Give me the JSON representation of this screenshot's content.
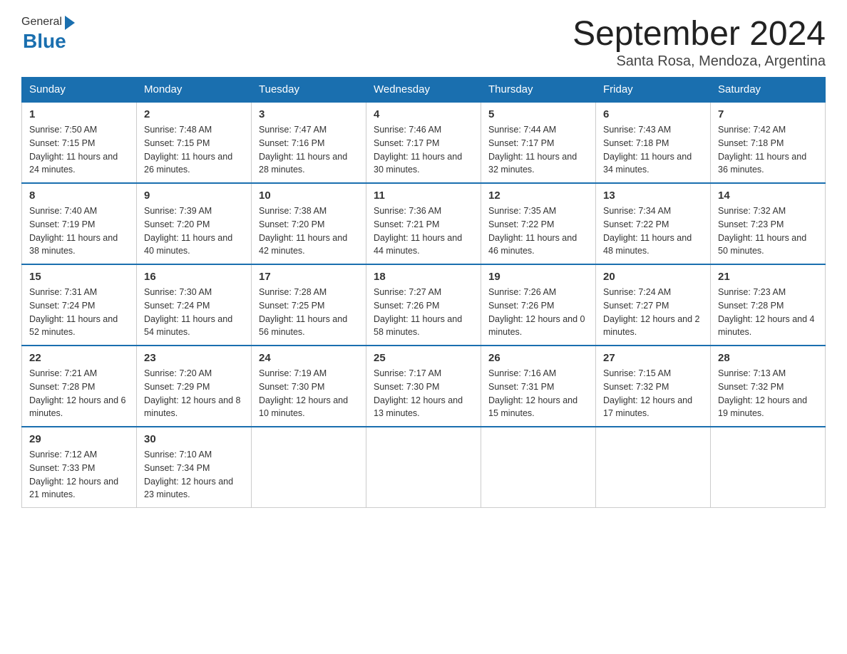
{
  "header": {
    "logo_general": "General",
    "logo_blue": "Blue",
    "month_title": "September 2024",
    "location": "Santa Rosa, Mendoza, Argentina"
  },
  "weekdays": [
    "Sunday",
    "Monday",
    "Tuesday",
    "Wednesday",
    "Thursday",
    "Friday",
    "Saturday"
  ],
  "weeks": [
    [
      {
        "day": "1",
        "sunrise": "7:50 AM",
        "sunset": "7:15 PM",
        "daylight": "11 hours and 24 minutes."
      },
      {
        "day": "2",
        "sunrise": "7:48 AM",
        "sunset": "7:15 PM",
        "daylight": "11 hours and 26 minutes."
      },
      {
        "day": "3",
        "sunrise": "7:47 AM",
        "sunset": "7:16 PM",
        "daylight": "11 hours and 28 minutes."
      },
      {
        "day": "4",
        "sunrise": "7:46 AM",
        "sunset": "7:17 PM",
        "daylight": "11 hours and 30 minutes."
      },
      {
        "day": "5",
        "sunrise": "7:44 AM",
        "sunset": "7:17 PM",
        "daylight": "11 hours and 32 minutes."
      },
      {
        "day": "6",
        "sunrise": "7:43 AM",
        "sunset": "7:18 PM",
        "daylight": "11 hours and 34 minutes."
      },
      {
        "day": "7",
        "sunrise": "7:42 AM",
        "sunset": "7:18 PM",
        "daylight": "11 hours and 36 minutes."
      }
    ],
    [
      {
        "day": "8",
        "sunrise": "7:40 AM",
        "sunset": "7:19 PM",
        "daylight": "11 hours and 38 minutes."
      },
      {
        "day": "9",
        "sunrise": "7:39 AM",
        "sunset": "7:20 PM",
        "daylight": "11 hours and 40 minutes."
      },
      {
        "day": "10",
        "sunrise": "7:38 AM",
        "sunset": "7:20 PM",
        "daylight": "11 hours and 42 minutes."
      },
      {
        "day": "11",
        "sunrise": "7:36 AM",
        "sunset": "7:21 PM",
        "daylight": "11 hours and 44 minutes."
      },
      {
        "day": "12",
        "sunrise": "7:35 AM",
        "sunset": "7:22 PM",
        "daylight": "11 hours and 46 minutes."
      },
      {
        "day": "13",
        "sunrise": "7:34 AM",
        "sunset": "7:22 PM",
        "daylight": "11 hours and 48 minutes."
      },
      {
        "day": "14",
        "sunrise": "7:32 AM",
        "sunset": "7:23 PM",
        "daylight": "11 hours and 50 minutes."
      }
    ],
    [
      {
        "day": "15",
        "sunrise": "7:31 AM",
        "sunset": "7:24 PM",
        "daylight": "11 hours and 52 minutes."
      },
      {
        "day": "16",
        "sunrise": "7:30 AM",
        "sunset": "7:24 PM",
        "daylight": "11 hours and 54 minutes."
      },
      {
        "day": "17",
        "sunrise": "7:28 AM",
        "sunset": "7:25 PM",
        "daylight": "11 hours and 56 minutes."
      },
      {
        "day": "18",
        "sunrise": "7:27 AM",
        "sunset": "7:26 PM",
        "daylight": "11 hours and 58 minutes."
      },
      {
        "day": "19",
        "sunrise": "7:26 AM",
        "sunset": "7:26 PM",
        "daylight": "12 hours and 0 minutes."
      },
      {
        "day": "20",
        "sunrise": "7:24 AM",
        "sunset": "7:27 PM",
        "daylight": "12 hours and 2 minutes."
      },
      {
        "day": "21",
        "sunrise": "7:23 AM",
        "sunset": "7:28 PM",
        "daylight": "12 hours and 4 minutes."
      }
    ],
    [
      {
        "day": "22",
        "sunrise": "7:21 AM",
        "sunset": "7:28 PM",
        "daylight": "12 hours and 6 minutes."
      },
      {
        "day": "23",
        "sunrise": "7:20 AM",
        "sunset": "7:29 PM",
        "daylight": "12 hours and 8 minutes."
      },
      {
        "day": "24",
        "sunrise": "7:19 AM",
        "sunset": "7:30 PM",
        "daylight": "12 hours and 10 minutes."
      },
      {
        "day": "25",
        "sunrise": "7:17 AM",
        "sunset": "7:30 PM",
        "daylight": "12 hours and 13 minutes."
      },
      {
        "day": "26",
        "sunrise": "7:16 AM",
        "sunset": "7:31 PM",
        "daylight": "12 hours and 15 minutes."
      },
      {
        "day": "27",
        "sunrise": "7:15 AM",
        "sunset": "7:32 PM",
        "daylight": "12 hours and 17 minutes."
      },
      {
        "day": "28",
        "sunrise": "7:13 AM",
        "sunset": "7:32 PM",
        "daylight": "12 hours and 19 minutes."
      }
    ],
    [
      {
        "day": "29",
        "sunrise": "7:12 AM",
        "sunset": "7:33 PM",
        "daylight": "12 hours and 21 minutes."
      },
      {
        "day": "30",
        "sunrise": "7:10 AM",
        "sunset": "7:34 PM",
        "daylight": "12 hours and 23 minutes."
      },
      null,
      null,
      null,
      null,
      null
    ]
  ],
  "labels": {
    "sunrise": "Sunrise:",
    "sunset": "Sunset:",
    "daylight": "Daylight:"
  }
}
